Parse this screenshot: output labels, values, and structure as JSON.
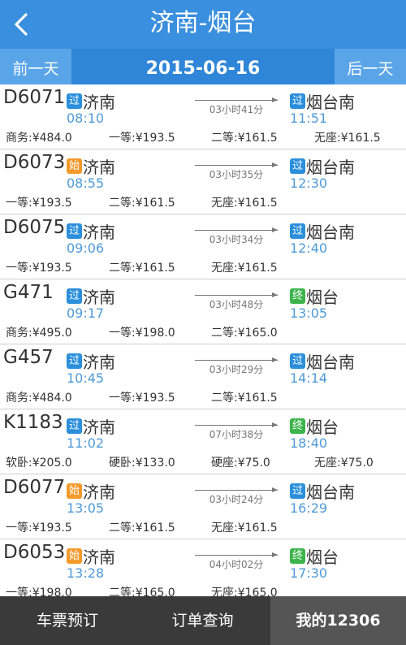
{
  "header": {
    "title": "济南-烟台",
    "back_icon": "chevron-left-icon"
  },
  "date_bar": {
    "prev_label": "前一天",
    "date": "2015-06-16",
    "next_label": "后一天"
  },
  "colors": {
    "header_blue": "#3a8fde",
    "tag_pass": "#2b8fdb",
    "tag_start": "#f39a2b",
    "tag_end": "#3cb44b",
    "time_blue": "#4e9ad8",
    "bottom_bar": "#3a3a3a",
    "bottom_active": "#555555"
  },
  "trains": [
    {
      "no": "D6071",
      "from_tag": "过",
      "from_type": "pass",
      "from": "济南",
      "dep": "08:10",
      "duration": "03小时41分",
      "to_tag": "过",
      "to_type": "pass",
      "to": "烟台南",
      "arr": "11:51",
      "prices": [
        "商务:¥484.0",
        "一等:¥193.5",
        "二等:¥161.5",
        "无座:¥161.5"
      ]
    },
    {
      "no": "D6073",
      "from_tag": "始",
      "from_type": "start",
      "from": "济南",
      "dep": "08:55",
      "duration": "03小时35分",
      "to_tag": "过",
      "to_type": "pass",
      "to": "烟台南",
      "arr": "12:30",
      "prices": [
        "一等:¥193.5",
        "二等:¥161.5",
        "无座:¥161.5"
      ]
    },
    {
      "no": "D6075",
      "from_tag": "过",
      "from_type": "pass",
      "from": "济南",
      "dep": "09:06",
      "duration": "03小时34分",
      "to_tag": "过",
      "to_type": "pass",
      "to": "烟台南",
      "arr": "12:40",
      "prices": [
        "一等:¥193.5",
        "二等:¥161.5",
        "无座:¥161.5"
      ]
    },
    {
      "no": "G471",
      "from_tag": "过",
      "from_type": "pass",
      "from": "济南",
      "dep": "09:17",
      "duration": "03小时48分",
      "to_tag": "终",
      "to_type": "end",
      "to": "烟台",
      "arr": "13:05",
      "prices": [
        "商务:¥495.0",
        "一等:¥198.0",
        "二等:¥165.0"
      ]
    },
    {
      "no": "G457",
      "from_tag": "过",
      "from_type": "pass",
      "from": "济南",
      "dep": "10:45",
      "duration": "03小时29分",
      "to_tag": "过",
      "to_type": "pass",
      "to": "烟台南",
      "arr": "14:14",
      "prices": [
        "商务:¥484.0",
        "一等:¥193.5",
        "二等:¥161.5"
      ]
    },
    {
      "no": "K1183",
      "from_tag": "过",
      "from_type": "pass",
      "from": "济南",
      "dep": "11:02",
      "duration": "07小时38分",
      "to_tag": "终",
      "to_type": "end",
      "to": "烟台",
      "arr": "18:40",
      "prices": [
        "软卧:¥205.0",
        "硬卧:¥133.0",
        "硬座:¥75.0",
        "无座:¥75.0"
      ]
    },
    {
      "no": "D6077",
      "from_tag": "始",
      "from_type": "start",
      "from": "济南",
      "dep": "13:05",
      "duration": "03小时24分",
      "to_tag": "过",
      "to_type": "pass",
      "to": "烟台南",
      "arr": "16:29",
      "prices": [
        "一等:¥193.5",
        "二等:¥161.5",
        "无座:¥161.5"
      ]
    },
    {
      "no": "D6053",
      "from_tag": "始",
      "from_type": "start",
      "from": "济南",
      "dep": "13:28",
      "duration": "04小时02分",
      "to_tag": "终",
      "to_type": "end",
      "to": "烟台",
      "arr": "17:30",
      "prices": [
        "一等:¥198.0",
        "二等:¥165.0",
        "无座:¥165.0"
      ]
    }
  ],
  "bottom_nav": {
    "tabs": [
      {
        "label": "车票预订"
      },
      {
        "label": "订单查询"
      },
      {
        "label": "我的12306"
      }
    ],
    "active_index": 2
  }
}
